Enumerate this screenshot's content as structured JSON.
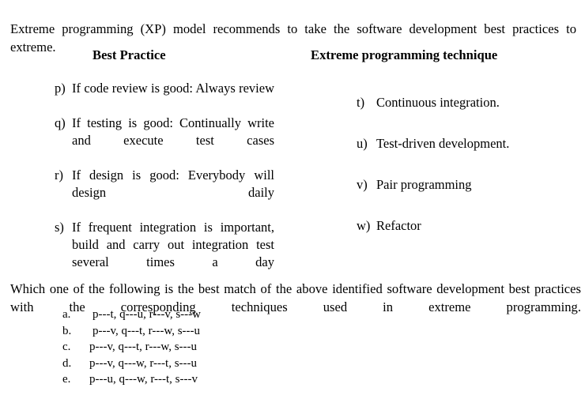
{
  "document": {
    "intro": "Extreme programming (XP) model recommends  to take the software development best practices to extreme.",
    "headings": {
      "left": "Best Practice",
      "right": "Extreme programming technique"
    },
    "best_practices": [
      {
        "marker": "p)",
        "text": "If code review is good: Always review"
      },
      {
        "marker": "q)",
        "text": "If testing is good: Continually write and execute test cases"
      },
      {
        "marker": "r)",
        "text": "If design is good: Everybody will design daily"
      },
      {
        "marker": "s)",
        "text": "If frequent integration is important, build and carry out integration test several times a day"
      }
    ],
    "techniques": [
      {
        "marker": "t)",
        "text": "Continuous integration."
      },
      {
        "marker": "u)",
        "text": "Test-driven development."
      },
      {
        "marker": "v)",
        "text": "Pair programming"
      },
      {
        "marker": "w)",
        "text": "Refactor"
      }
    ],
    "question": "Which one of the following is the best match of the above identified software development best practices with the corresponding techniques used in  extreme programming.",
    "options": [
      {
        "letter": "a.",
        "text": "p---t, q---u, r---v, s---w"
      },
      {
        "letter": "b.",
        "text": "p---v, q---t, r---w, s---u"
      },
      {
        "letter": "c.",
        "text": "p---v, q---t, r---w, s---u"
      },
      {
        "letter": "d.",
        "text": "p---v, q---w, r---t, s---u"
      },
      {
        "letter": "e.",
        "text": "p---u, q---w, r---t, s---v"
      }
    ]
  },
  "colors": {
    "text": "#000000",
    "background": "#ffffff"
  }
}
